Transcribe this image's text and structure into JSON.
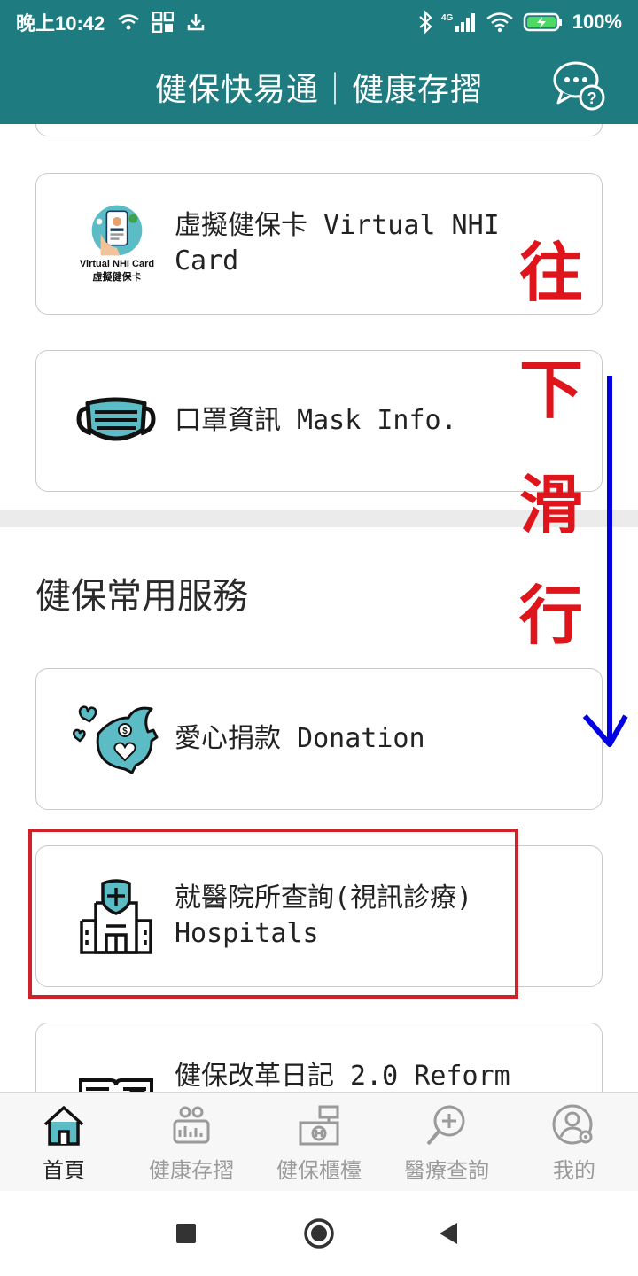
{
  "status": {
    "time": "晚上10:42",
    "battery": "100%",
    "network": "4G"
  },
  "header": {
    "title": "健保快易通｜健康存摺",
    "chat_icon": "chat-help-icon"
  },
  "cards": [
    {
      "id": "virtual-nhi",
      "label_line1": "虛擬健保卡 Virtual NHI",
      "label_line2": "Card",
      "icon_caption1": "Virtual NHI Card",
      "icon_caption2": "虛擬健保卡"
    },
    {
      "id": "mask-info",
      "label": "口罩資訊 Mask Info."
    }
  ],
  "section": {
    "title": "健保常用服務"
  },
  "service_cards": [
    {
      "id": "donation",
      "label": "愛心捐款 Donation"
    },
    {
      "id": "hospitals",
      "label_line1": "就醫院所查詢(視訊診療)",
      "label_line2": "Hospitals"
    },
    {
      "id": "reform",
      "label": "健保改革日記 2.0 Reform"
    }
  ],
  "overlay": {
    "chars": [
      "往",
      "下",
      "滑",
      "行"
    ],
    "color": "#e0141b",
    "arrow_color": "#0000e0",
    "box_color": "#d2202a"
  },
  "bottom_nav": [
    {
      "label": "首頁",
      "icon": "home-icon",
      "active": true
    },
    {
      "label": "健康存摺",
      "icon": "health-passbook-icon",
      "active": false
    },
    {
      "label": "健保櫃檯",
      "icon": "counter-icon",
      "active": false
    },
    {
      "label": "醫療查詢",
      "icon": "medical-search-icon",
      "active": false
    },
    {
      "label": "我的",
      "icon": "user-settings-icon",
      "active": false
    }
  ],
  "colors": {
    "brand": "#1e7b80",
    "accent_icon": "#5bbcc5"
  }
}
